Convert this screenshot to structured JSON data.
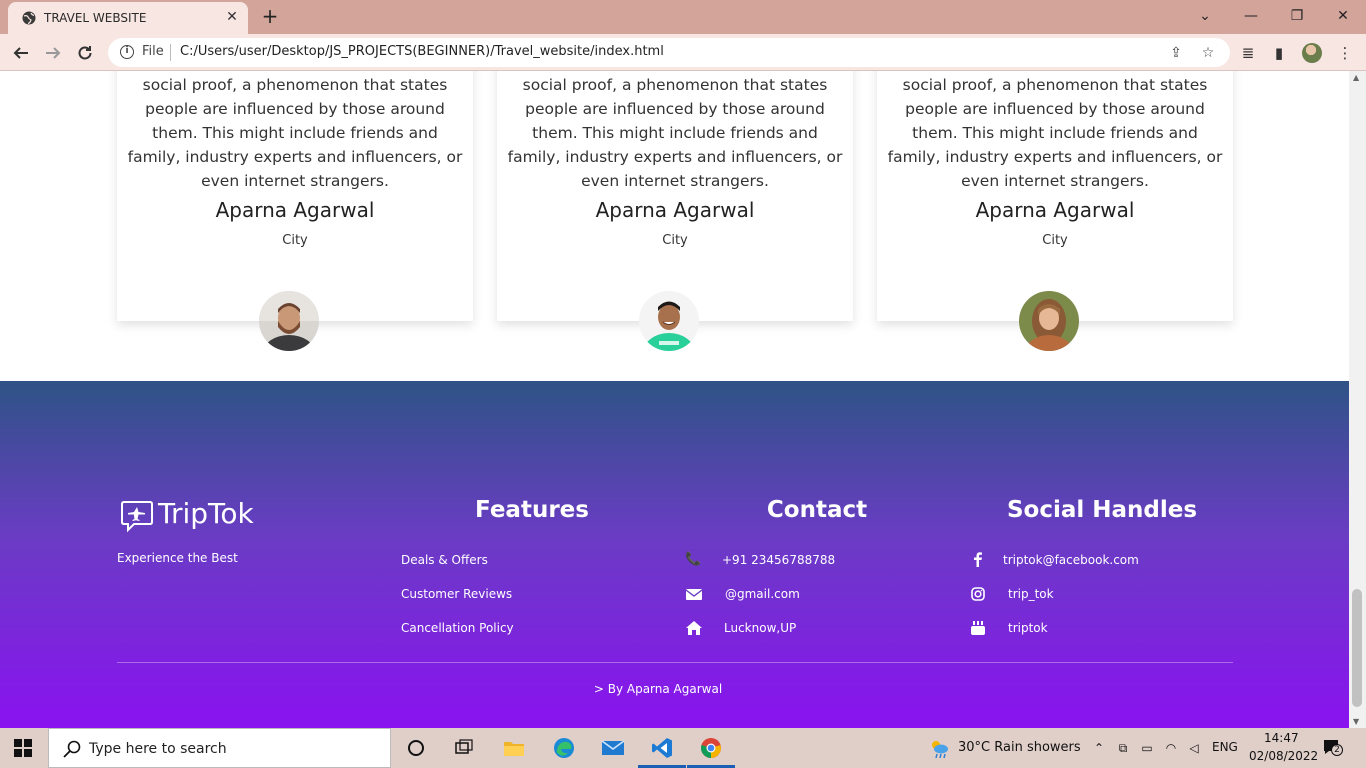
{
  "browser": {
    "tab_title": "TRAVEL WEBSITE",
    "url_scheme": "File",
    "url": "C:/Users/user/Desktop/JS_PROJECTS(BEGINNER)/Travel_website/index.html"
  },
  "testimonials": [
    {
      "text": "social proof, a phenomenon that states people are influenced by those around them. This might include friends and family, industry experts and influencers, or even internet strangers.",
      "name": "Aparna Agarwal",
      "city": "City"
    },
    {
      "text": "social proof, a phenomenon that states people are influenced by those around them. This might include friends and family, industry experts and influencers, or even internet strangers.",
      "name": "Aparna Agarwal",
      "city": "City"
    },
    {
      "text": "social proof, a phenomenon that states people are influenced by those around them. This might include friends and family, industry experts and influencers, or even internet strangers.",
      "name": "Aparna Agarwal",
      "city": "City"
    }
  ],
  "footer": {
    "brand": "TripTok",
    "tagline": "Experience the Best",
    "features": {
      "heading": "Features",
      "links": [
        "Deals & Offers",
        "Customer Reviews",
        "Cancellation Policy"
      ]
    },
    "contact": {
      "heading": "Contact",
      "phone": "+91 23456788788",
      "email": "@gmail.com",
      "address": "Lucknow,UP"
    },
    "social": {
      "heading": "Social Handles",
      "facebook": "triptok@facebook.com",
      "instagram": "trip_tok",
      "youtube": "triptok"
    },
    "credit": "> By Aparna Agarwal",
    "gradient_top": "#2e5386",
    "gradient_bottom": "#8a12f0"
  },
  "taskbar": {
    "search_placeholder": "Type here to search",
    "weather": "30°C  Rain showers",
    "language": "ENG",
    "time": "14:47",
    "date": "02/08/2022",
    "notification_count": "2"
  }
}
